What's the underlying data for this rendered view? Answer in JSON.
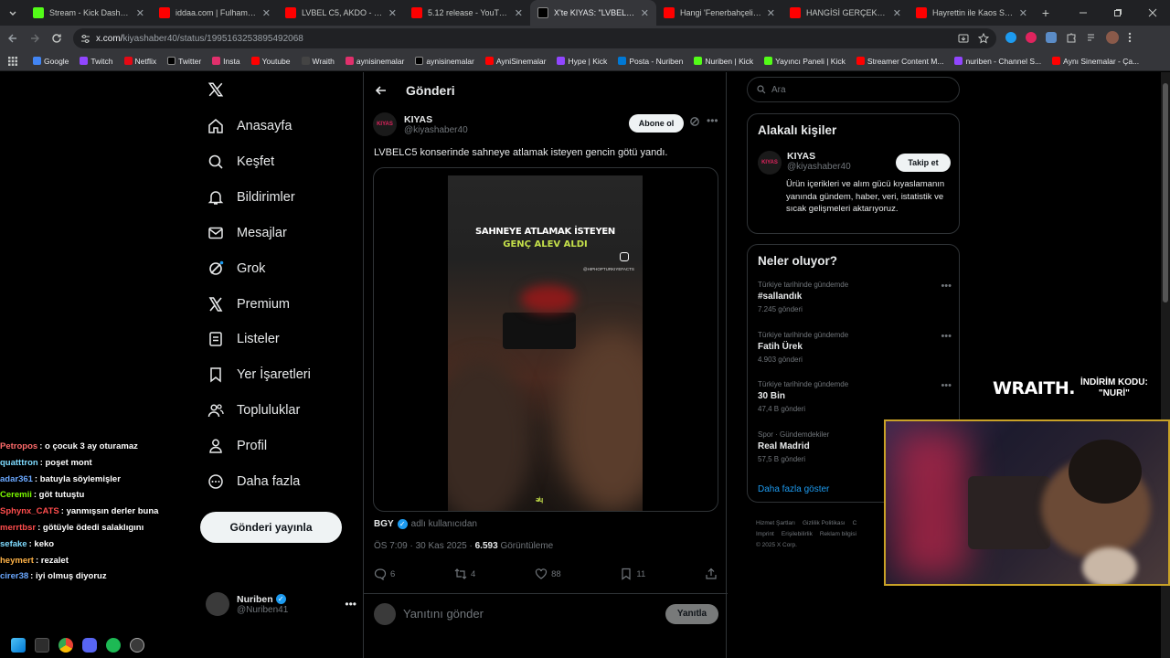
{
  "browser": {
    "tabs": [
      {
        "title": "Stream - Kick Dashboard",
        "icon": "kick-icon",
        "color": "#53fc18"
      },
      {
        "title": "iddaa.com | Fulham (4-5)",
        "icon": "youtube-icon",
        "color": "#ff0000"
      },
      {
        "title": "LVBEL C5, AKDO - COOOL",
        "icon": "youtube-icon",
        "color": "#ff0000"
      },
      {
        "title": "5.12 release - YouTube",
        "icon": "youtube-icon",
        "color": "#ff0000"
      },
      {
        "title": "X'te KIYAS: \"LVBELC5 k",
        "icon": "x-icon",
        "color": "#000000",
        "active": true
      },
      {
        "title": "Hangi 'Fenerbahçeli' Aslın",
        "icon": "youtube-icon",
        "color": "#ff0000"
      },
      {
        "title": "HANGİSİ GERÇEK ESPORC",
        "icon": "youtube-icon",
        "color": "#ff0000"
      },
      {
        "title": "Hayrettin ile Kaos Show -",
        "icon": "youtube-icon",
        "color": "#ff0000"
      }
    ],
    "new_tab": "+",
    "url_host": "x.com/",
    "url_path": "kiyashaber40/status/1995163253895492068",
    "bookmarks": [
      {
        "label": "Google",
        "color": "#4285f4"
      },
      {
        "label": "Twitch",
        "color": "#9146ff"
      },
      {
        "label": "Netflix",
        "color": "#e50914"
      },
      {
        "label": "Twitter",
        "color": "#000000"
      },
      {
        "label": "Insta",
        "color": "#e1306c"
      },
      {
        "label": "Youtube",
        "color": "#ff0000"
      },
      {
        "label": "Wraith",
        "color": "#444444"
      },
      {
        "label": "aynisinemalar",
        "color": "#e1306c"
      },
      {
        "label": "aynisinemalar",
        "color": "#000000"
      },
      {
        "label": "AyniSinemalar",
        "color": "#ff0000"
      },
      {
        "label": "Hype | Kick",
        "color": "#9146ff"
      },
      {
        "label": "Posta - Nuriben",
        "color": "#0078d4"
      },
      {
        "label": "Nuriben | Kick",
        "color": "#53fc18"
      },
      {
        "label": "Yayıncı Paneli | Kick",
        "color": "#53fc18"
      },
      {
        "label": "Streamer Content M...",
        "color": "#ff0000"
      },
      {
        "label": "nuriben - Channel S...",
        "color": "#9146ff"
      },
      {
        "label": "Aynı Sinemalar - Ça...",
        "color": "#ff0000"
      }
    ]
  },
  "nav": {
    "items": [
      {
        "label": "Anasayfa",
        "icon": "home-icon"
      },
      {
        "label": "Keşfet",
        "icon": "search-icon"
      },
      {
        "label": "Bildirimler",
        "icon": "bell-icon"
      },
      {
        "label": "Mesajlar",
        "icon": "mail-icon"
      },
      {
        "label": "Grok",
        "icon": "grok-icon"
      },
      {
        "label": "Premium",
        "icon": "x-icon"
      },
      {
        "label": "Listeler",
        "icon": "list-icon"
      },
      {
        "label": "Yer İşaretleri",
        "icon": "bookmark-icon"
      },
      {
        "label": "Topluluklar",
        "icon": "people-icon"
      },
      {
        "label": "Profil",
        "icon": "person-icon"
      },
      {
        "label": "Daha fazla",
        "icon": "more-circle-icon"
      }
    ],
    "post_button": "Gönderi yayınla",
    "account": {
      "name": "Nuriben",
      "handle": "@Nuriben41"
    }
  },
  "post": {
    "header_title": "Gönderi",
    "author_avatar": "KIYAS",
    "author_name": "KIYAS",
    "author_handle": "@kiyashaber40",
    "follow_label": "Abone ol",
    "text": "LVBELC5 konserinde sahneye atlamak isteyen gencin götü yandı.",
    "video": {
      "caption_1": "SAHNEYE ATLAMAK İSTEYEN",
      "caption_2": "GENÇ ALEV ALDI",
      "watermark": "@HIPHOPTURKIYEFACTS",
      "logo": "ǝ̸ɥ"
    },
    "source_user": "BGY",
    "source_suffix": "adlı kullanıcıdan",
    "time": "ÖS 7:09 · 30 Kas 2025 ·",
    "views": "6.593",
    "views_label": "Görüntüleme",
    "counts": {
      "replies": "6",
      "reposts": "4",
      "likes": "88",
      "bookmarks": "11"
    },
    "reply_placeholder": "Yanıtını gönder",
    "reply_button": "Yanıtla"
  },
  "sidebar": {
    "search_placeholder": "Ara",
    "related_title": "Alakalı kişiler",
    "related_avatar": "KIYAS",
    "related_name": "KIYAS",
    "related_handle": "@kiyashaber40",
    "related_follow": "Takip et",
    "related_bio": "Ürün içerikleri ve alım gücü kıyaslamanın yanında gündem, haber, veri, istatistik ve sıcak gelişmeleri aktarıyoruz.",
    "trends_title": "Neler oluyor?",
    "trends": [
      {
        "context": "Türkiye tarihinde gündemde",
        "name": "#sallandık",
        "count": "7.245 gönderi"
      },
      {
        "context": "Türkiye tarihinde gündemde",
        "name": "Fatih Ürek",
        "count": "4.903 gönderi"
      },
      {
        "context": "Türkiye tarihinde gündemde",
        "name": "30 Bin",
        "count": "47,4 B gönderi"
      },
      {
        "context": "Spor · Gündemdekiler",
        "name": "Real Madrid",
        "count": "57,5 B gönderi"
      }
    ],
    "show_more": "Daha fazla göster",
    "footer": [
      "Hizmet Şartları",
      "Gizlilik Politikası",
      "C",
      "Imprint",
      "Erişilebilirlik",
      "Reklam bilgisi",
      "© 2025 X Corp."
    ]
  },
  "overlay": {
    "sponsor_brand": "WRAITH.",
    "sponsor_line1": "İNDİRİM KODU:",
    "sponsor_line2": "\"NURİ\"",
    "chat": [
      {
        "user": "Petropos",
        "msg": "o çocuk 3 ay oturamaz",
        "color": "#ff6b6b"
      },
      {
        "user": "quatttron",
        "msg": "poşet mont",
        "color": "#7fdbff"
      },
      {
        "user": "adar361",
        "msg": "batuyla söylemişler",
        "color": "#6aa8ff"
      },
      {
        "user": "Ceremii",
        "msg": "göt tutuştu",
        "color": "#7cfc00"
      },
      {
        "user": "Sphynx_CATS",
        "msg": "yanmışsın derler buna",
        "color": "#ff4d4d"
      },
      {
        "user": "merrtbsr",
        "msg": "götüyle ödedi salaklıgını",
        "color": "#ff4d4d"
      },
      {
        "user": "sefake",
        "msg": "keko",
        "color": "#7fdbff"
      },
      {
        "user": "heymert",
        "msg": "rezalet",
        "color": "#ffb347"
      },
      {
        "user": "cirer38",
        "msg": "iyi olmuş diyoruz",
        "color": "#6aa8ff"
      }
    ]
  }
}
